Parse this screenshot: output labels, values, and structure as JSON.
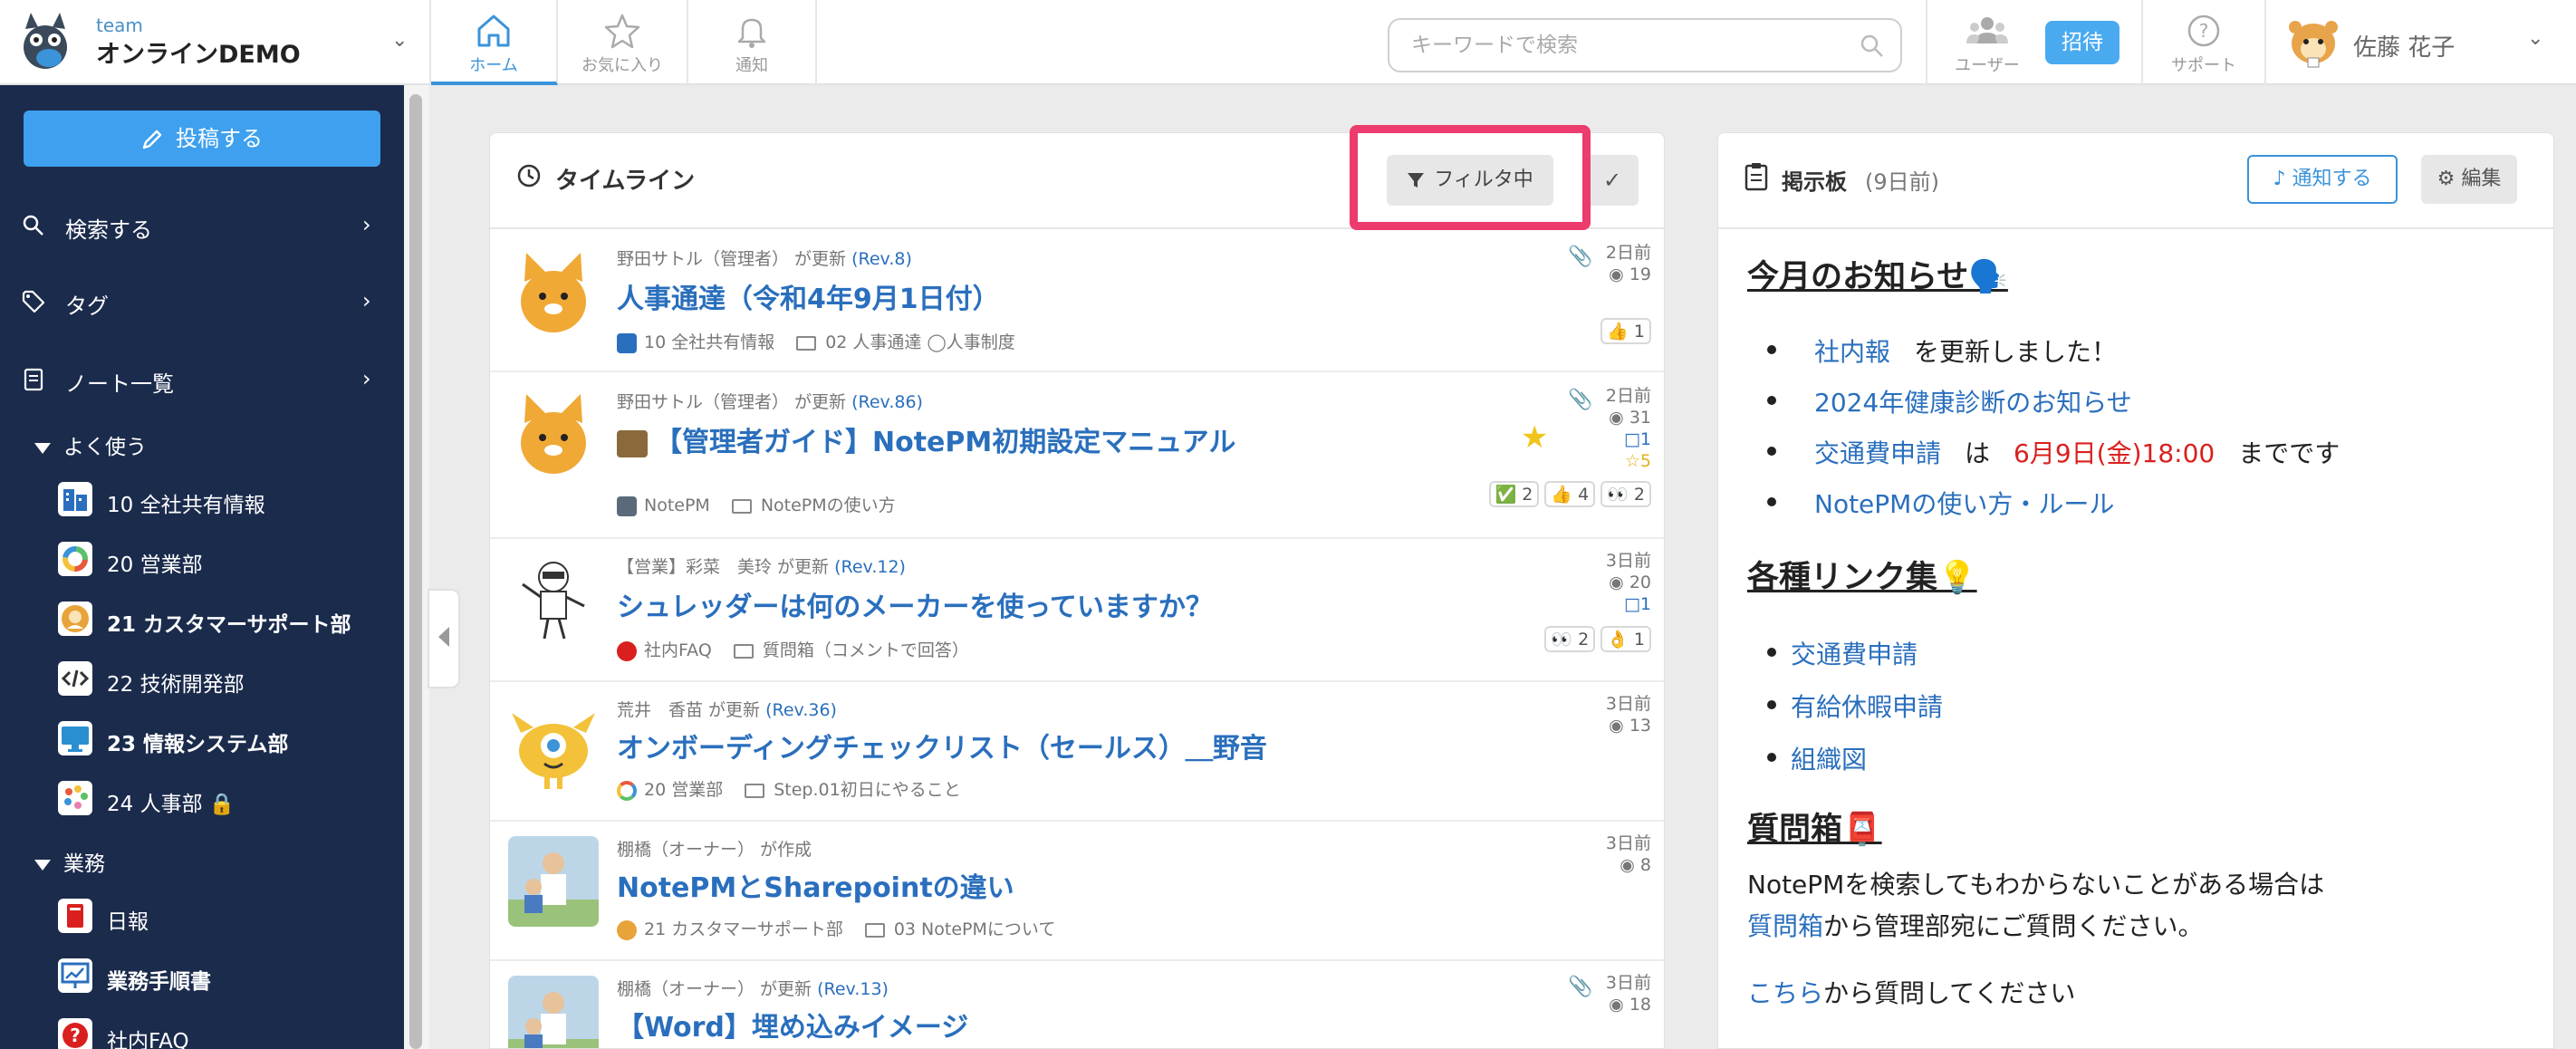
{
  "header": {
    "team_small": "team",
    "team_name": "オンラインDEMO",
    "tabs": [
      {
        "label": "ホーム",
        "icon": "home-icon",
        "active": true
      },
      {
        "label": "お気に入り",
        "icon": "star-icon",
        "active": false
      },
      {
        "label": "通知",
        "icon": "bell-icon",
        "active": false
      }
    ],
    "search_placeholder": "キーワードで検索",
    "users_label": "ユーザー",
    "invite_label": "招待",
    "support_label": "サポート",
    "user_name": "佐藤 花子",
    "accent": "#3b93d9"
  },
  "sidebar": {
    "post_label": "投稿する",
    "nav": [
      {
        "label": "検索する",
        "icon": "search-icon"
      },
      {
        "label": "タグ",
        "icon": "tag-icon"
      },
      {
        "label": "ノート一覧",
        "icon": "note-icon"
      }
    ],
    "sections": [
      {
        "label": "よく使う"
      },
      {
        "label": "業務"
      }
    ],
    "favorites": [
      {
        "label": "10 全社共有情報",
        "bold": false,
        "color": "#2a6fbd"
      },
      {
        "label": "20 営業部",
        "bold": false,
        "color": "#e85a3a"
      },
      {
        "label": "21 カスタマーサポート部",
        "bold": true,
        "color": "#e8a33a"
      },
      {
        "label": "22 技術開発部",
        "bold": false,
        "color": "#333333"
      },
      {
        "label": "23 情報システム部",
        "bold": true,
        "color": "#2a8fd0"
      },
      {
        "label": "24 人事部",
        "bold": false,
        "color": "#e87fb0",
        "locked": true
      }
    ],
    "work": [
      {
        "label": "日報",
        "bold": false,
        "color": "#d9201e"
      },
      {
        "label": "業務手順書",
        "bold": true,
        "color": "#2a6fbd"
      },
      {
        "label": "社内FAQ",
        "bold": false,
        "color": "#d9201e"
      }
    ],
    "bg": "#1b2b4c"
  },
  "timeline": {
    "title": "タイムライン",
    "filter_label": "フィルタ中",
    "entries": [
      {
        "meta": "野田サトル（管理者） が更新",
        "rev": "(Rev.8)",
        "title": "人事通達（令和4年9月1日付）",
        "category": "10 全社共有情報",
        "folder": "02 人事通達",
        "tag": "人事制度",
        "ago": "2日前",
        "views": "19",
        "reactions": [
          "👍 1"
        ]
      },
      {
        "meta": "野田サトル（管理者） が更新",
        "rev": "(Rev.86)",
        "title": "【管理者ガイド】NotePM初期設定マニュアル",
        "category": "NotePM",
        "folder": "NotePMの使い方",
        "ago": "2日前",
        "views": "31",
        "comments": "1",
        "stars": "5",
        "reactions": [
          "✅ 2",
          "👍 4",
          "👀 2"
        ]
      },
      {
        "meta": "【営業】彩菜　美玲 が更新",
        "rev": "(Rev.12)",
        "title": "シュレッダーは何のメーカーを使っていますか？",
        "category": "社内FAQ",
        "folder": "質問箱（コメントで回答）",
        "ago": "3日前",
        "views": "20",
        "comments": "1",
        "reactions": [
          "👀 2",
          "👌 1"
        ]
      },
      {
        "meta": "荒井　香苗 が更新",
        "rev": "(Rev.36)",
        "title": "オンボーディングチェックリスト（セールス）＿野音",
        "category": "20 営業部",
        "folder": "Step.01初日にやること",
        "ago": "3日前",
        "views": "13"
      },
      {
        "meta": "棚橋（オーナー） が作成",
        "rev": "",
        "title": "NotePMとSharepointの違い",
        "category": "21 カスタマーサポート部",
        "folder": "03 NotePMについて",
        "ago": "3日前",
        "views": "8"
      },
      {
        "meta": "棚橋（オーナー） が更新",
        "rev": "(Rev.13)",
        "title": "【Word】埋め込みイメージ",
        "ago": "3日前",
        "views": "18"
      }
    ]
  },
  "board": {
    "title": "掲示板",
    "ago": "(9日前)",
    "notify_label": "通知する",
    "edit_label": "編集",
    "h_notice": "今月のお知らせ🗣️",
    "notice_items": [
      {
        "link": "社内報",
        "rest": "を更新しました！"
      },
      {
        "link": "2024年健康診断のお知らせ",
        "rest": ""
      },
      {
        "link": "交通費申請",
        "mid": "は",
        "red": "6月9日(金)18:00",
        "rest": "までです"
      },
      {
        "link": "NotePMの使い方・ルール",
        "rest": ""
      }
    ],
    "h_links": "各種リンク集💡",
    "link_items": [
      "交通費申請",
      "有給休暇申請",
      "組織図"
    ],
    "h_qa": "質問箱📮",
    "qa_line1": "NotePMを検索してもわからないことがある場合は",
    "qa_link": "質問箱",
    "qa_line2_rest": "から管理部宛にご質問ください。",
    "qa_here_link": "こちら",
    "qa_here_rest": "から質問してください"
  }
}
